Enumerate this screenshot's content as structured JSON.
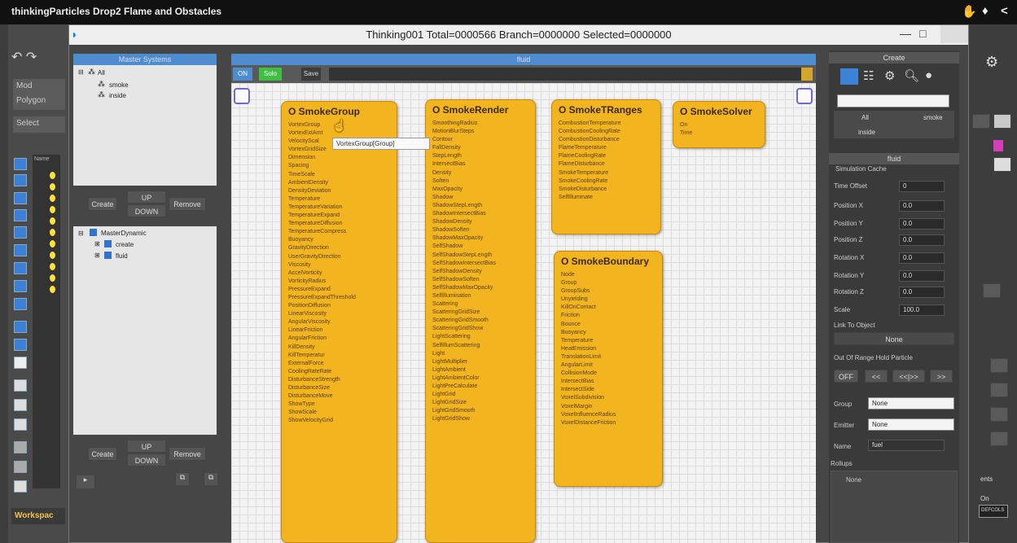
{
  "outer_title": "thinkingParticles Drop2 Flame and Obstacles",
  "window": {
    "title": "Thinking001  Total=0000566  Branch=0000000  Selected=0000000"
  },
  "max_ui": {
    "left_tab_1": "Mod",
    "left_tab_2": "Polygon",
    "left_tab_3": "Select",
    "workspace": "Workspac",
    "list_header": "Name"
  },
  "master_systems": {
    "header": "Master Systems",
    "items": [
      "All",
      "smoke",
      "inside"
    ],
    "create": "Create",
    "up": "UP",
    "down": "DOWN",
    "remove": "Remove"
  },
  "master_dynamic": {
    "items": [
      "MasterDynamic",
      "create",
      "fluid"
    ],
    "create": "Create",
    "up": "UP",
    "down": "DOWN",
    "remove": "Remove"
  },
  "canvas": {
    "header": "fluid",
    "btn_on": "ON",
    "btn_solo": "Solo",
    "btn_save": "Save",
    "tooltip": "VortexGroup[Group]"
  },
  "nodes": {
    "smoke_group": {
      "title": "O SmokeGroup",
      "ports": [
        "VortexGroup",
        "VortexExtAmt",
        "VelocityScal",
        "VortexGridSize",
        "Dimension",
        "Spacing",
        "TimeScale",
        "AmbientDensity",
        "DensityDeviation",
        "Temperature",
        "TemperatureVariation",
        "TemperatureExpand",
        "TemperatureDiffusion",
        "TemperatureCompress",
        "Buoyancy",
        "GravityDirection",
        "UserGravityDirection",
        "Viscosity",
        "AccelVorticity",
        "VorticityRadius",
        "PressureExpand",
        "PressureExpandThreshold",
        "PositionDiffusion",
        "LinearViscosity",
        "AngularViscosity",
        "LinearFriction",
        "AngularFriction",
        "KillDensity",
        "KillTemperatur",
        "ExternalForce",
        "CoolingRateRate",
        "DisturbanceStrength",
        "DisturbanceSize",
        "DisturbanceMove",
        "ShowType",
        "ShowScale",
        "ShowVelocityGrid"
      ]
    },
    "smoke_render": {
      "title": "O SmokeRender",
      "ports": [
        "SmoothingRadius",
        "MotionBlurSteps",
        "Contour",
        "FallDensity",
        "StepLength",
        "IntersectBias",
        "Density",
        "Soften",
        "MaxOpacity",
        "Shadow",
        "ShadowStepLength",
        "ShadowIntersectBias",
        "ShadowDensity",
        "ShadowSoften",
        "ShadowMaxOpacity",
        "SelfShadow",
        "SelfShadowStepLength",
        "SelfShadowIntersectBias",
        "SelfShadowDensity",
        "SelfShadowSoften",
        "SelfShadowMaxOpacity",
        "SelfIllumination",
        "Scattering",
        "ScatteringGridSize",
        "ScatteringGridSmooth",
        "ScatteringGridShow",
        "LightScattering",
        "SelfIllumScattering",
        "Light",
        "LightMultiplier",
        "LightAmbient",
        "LightAmbientColor",
        "LightPreCalculate",
        "LightGrid",
        "LightGridSize",
        "LightGridSmooth",
        "LightGridShow"
      ]
    },
    "smoke_tranges": {
      "title": "O SmokeTRanges",
      "ports": [
        "CombustionTemperature",
        "CombustionCoolingRate",
        "CombustionDisturbance",
        "FlameTemperature",
        "FlameCoolingRate",
        "FlameDisturbance",
        "SmokeTemperature",
        "SmokeCoolingRate",
        "SmokeDisturbance",
        "SelfIlluminate"
      ]
    },
    "smoke_solver": {
      "title": "O SmokeSolver",
      "ports": [
        "On",
        "Time"
      ]
    },
    "smoke_boundary": {
      "title": "O SmokeBoundary",
      "ports": [
        "Node",
        "Group",
        "GroupSubs",
        "Unyielding",
        "KillOnContact",
        "Friction",
        "Bounce",
        "Buoyancy",
        "Temperature",
        "HeatEmission",
        "TranslationLimit",
        "AngularLimit",
        "CollisionMode",
        "IntersectBias",
        "IntersectSide",
        "VoxelSubdivision",
        "VoxelMargin",
        "VoxelInfluenceRadius",
        "VoxelDistanceFriction"
      ]
    }
  },
  "right_panel": {
    "create_header": "Create",
    "col_all": "All",
    "col_smoke": "smoke",
    "row_inside": "inside",
    "fluid_header": "fluid",
    "sim_cache": "Simulation Cache",
    "time_offset_label": "Time Offset",
    "time_offset_value": "0",
    "params": [
      {
        "label": "Position X",
        "value": "0.0"
      },
      {
        "label": "Position Y",
        "value": "0.0"
      },
      {
        "label": "Position Z",
        "value": "0.0"
      },
      {
        "label": "Rotation X",
        "value": "0.0"
      },
      {
        "label": "Rotation Y",
        "value": "0.0"
      },
      {
        "label": "Rotation Z",
        "value": "0.0"
      },
      {
        "label": "Scale",
        "value": "100.0"
      }
    ],
    "link_to_object": "Link To Object",
    "none_btn": "None",
    "oor_label": "Out Of Range Hold Particle",
    "off": "OFF",
    "nav_prev": "<<",
    "nav_mid": "<<|>>",
    "nav_next": ">>",
    "group_label": "Group",
    "group_value": "None",
    "emitter_label": "Emitter",
    "emitter_value": "None",
    "name_label": "Name",
    "name_value": "fuel",
    "rollups_label": "Rollups",
    "rollups_item": "None"
  },
  "far_right": {
    "ents": "ents",
    "on": "On",
    "defcols": "DEFCOLS"
  }
}
